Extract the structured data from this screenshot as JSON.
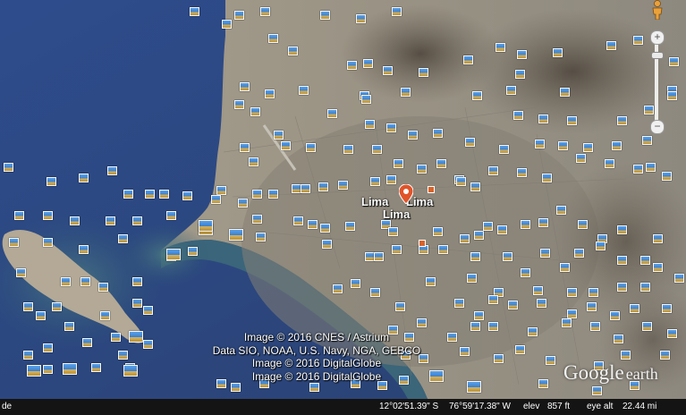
{
  "map": {
    "place_labels": [
      "Lima",
      "Lima",
      "Lima"
    ],
    "credits": [
      "Image © 2016 CNES / Astrium",
      "Data SIO, NOAA, U.S. Navy, NGA, GEBCO",
      "Image © 2016 DigitalGlobe",
      "Image © 2016 DigitalGlobe"
    ],
    "logo": {
      "google": "Google",
      "earth": "earth"
    },
    "colors": {
      "ocean": "#2c4a86",
      "shallow": "#3f6a7a",
      "land": "#9d9585",
      "urban": "#8f8a80",
      "hills": "#6a6156"
    },
    "icons": [
      "place-pin-icon",
      "photo-marker-icon",
      "pegman-icon",
      "zoom-in-icon",
      "zoom-out-icon"
    ]
  },
  "status_bar": {
    "left_fragment": "de",
    "latitude": "12°02'51.39\" S",
    "longitude": "76°59'17.38\" W",
    "elev_label": "elev",
    "elev_value": "857 ft",
    "eye_alt_label": "eye alt",
    "eye_alt_value": "22.44 mi"
  },
  "zoom": {
    "in_label": "+",
    "out_label": "−",
    "level": 0.1
  }
}
